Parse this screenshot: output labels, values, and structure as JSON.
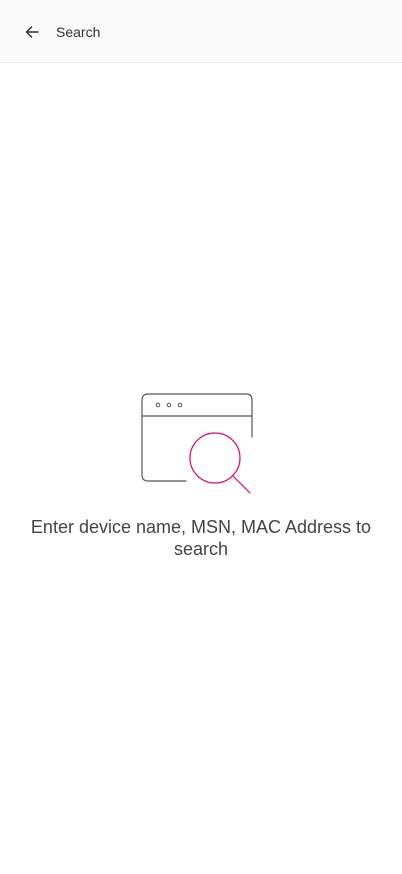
{
  "header": {
    "title": "Search",
    "back_icon": "arrow-left-icon"
  },
  "empty_state": {
    "illustration_icon": "browser-window-magnifier-icon",
    "message": "Enter device name, MSN, MAC Address to search"
  },
  "colors": {
    "accent": "#e0007a",
    "line": "#555555",
    "text": "#444444",
    "header_bg": "#fafafa"
  }
}
